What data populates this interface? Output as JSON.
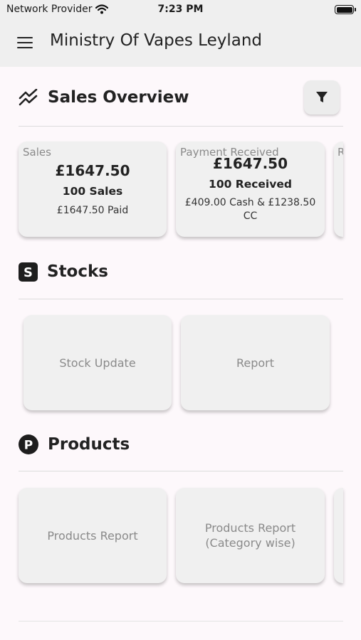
{
  "status_bar": {
    "carrier": "Network Provider",
    "time": "7:23 PM"
  },
  "app_bar": {
    "title": "Ministry Of Vapes Leyland"
  },
  "sales_overview": {
    "title": "Sales Overview",
    "cards": [
      {
        "label": "Sales",
        "amount": "£1647.50",
        "count": "100 Sales",
        "detail": "£1647.50 Paid"
      },
      {
        "label": "Payment Received",
        "amount": "£1647.50",
        "count": "100 Received",
        "detail": "£409.00 Cash & £1238.50 CC"
      },
      {
        "label": "R"
      }
    ]
  },
  "stocks": {
    "title": "Stocks",
    "cards": [
      {
        "label": "Stock Update"
      },
      {
        "label": "Report"
      }
    ]
  },
  "products": {
    "title": "Products",
    "cards": [
      {
        "label": "Products Report"
      },
      {
        "label": "Products Report (Category wise)"
      }
    ]
  },
  "colors": {
    "app_bar": "#efefef",
    "background": "#fdf8fb",
    "card": "#f0f0f0",
    "muted_text": "#8a8a8a"
  }
}
